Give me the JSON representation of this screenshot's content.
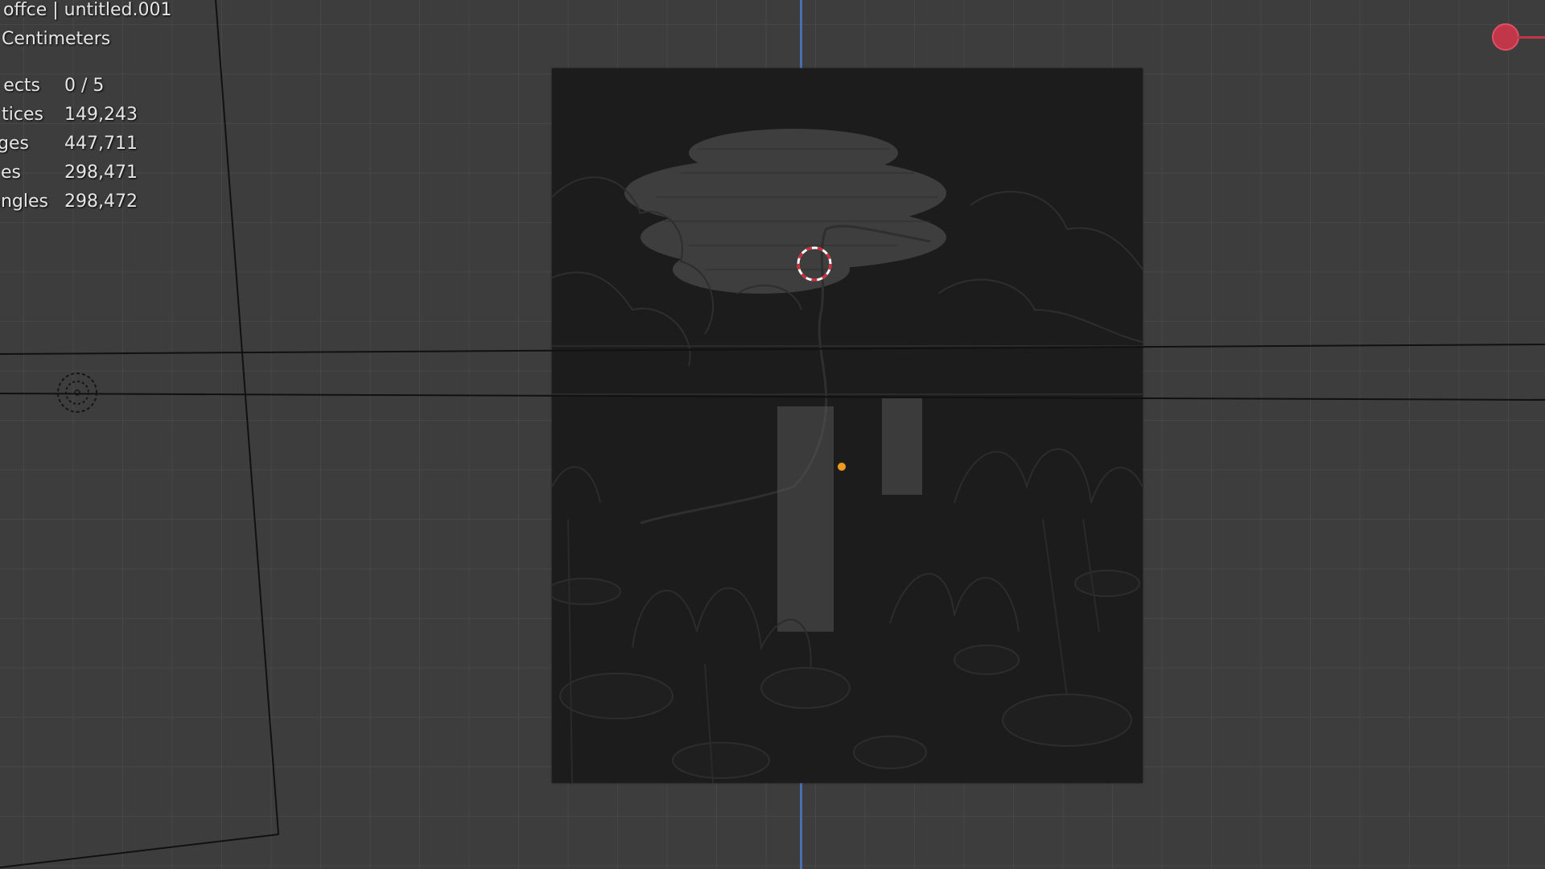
{
  "viewport": {
    "title": "offce | untitled.001",
    "units": "Centimeters",
    "stats": [
      {
        "label": "ects",
        "value": "0 / 5"
      },
      {
        "label": "tices",
        "value": "149,243"
      },
      {
        "label": "ges",
        "value": "447,711"
      },
      {
        "label": "es",
        "value": "298,471"
      },
      {
        "label": "angles",
        "value": "298,472"
      }
    ]
  },
  "icons": {
    "cursor": "3d-cursor-icon",
    "light": "light-icon",
    "gizmo_x": "x-axis-gizmo-icon",
    "origin": "object-origin-icon"
  },
  "colors": {
    "grid_background": "#3d3d3d",
    "grid_line": "#474747",
    "y_axis": "#4a6fb0",
    "x_gizmo": "#c2364a",
    "origin": "#f39a1e",
    "plane": "#1c1c1c"
  }
}
